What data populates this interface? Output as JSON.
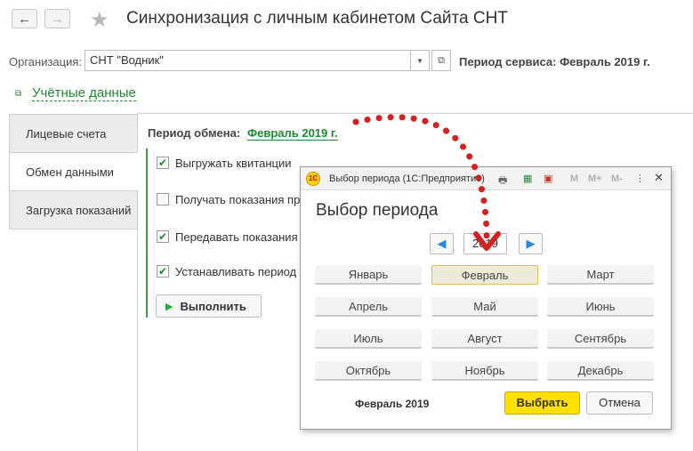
{
  "header": {
    "back_icon": "←",
    "forward_icon": "→",
    "favorite_icon": "★",
    "title": "Синхронизация с личным кабинетом Сайта СНТ"
  },
  "organization": {
    "label": "Организация:",
    "value": "СНТ \"Водник\"",
    "period_service": "Период сервиса: Февраль 2019 г."
  },
  "credentials_link": "Учётные данные",
  "tabs": [
    {
      "label": "Лицевые счета",
      "active": false
    },
    {
      "label": "Обмен данными",
      "active": true
    },
    {
      "label": "Загрузка показаний",
      "active": false
    }
  ],
  "exchange": {
    "period_label": "Период обмена:",
    "period_value": "Февраль 2019 г.",
    "options": [
      {
        "label": "Выгружать квитанции",
        "checked": true
      },
      {
        "label": "Получать показания пр",
        "checked": false
      },
      {
        "label": "Передавать показания",
        "checked": true
      },
      {
        "label": "Устанавливать период",
        "checked": true
      }
    ],
    "run_button": "Выполнить"
  },
  "dialog": {
    "caption": "Выбор периода  (1С:Предприятие)",
    "logo": "1С",
    "toolbar_m": [
      "M",
      "M+",
      "M-"
    ],
    "heading": "Выбор периода",
    "year": "2019",
    "months": [
      "Январь",
      "Февраль",
      "Март",
      "Апрель",
      "Май",
      "Июнь",
      "Июль",
      "Август",
      "Сентябрь",
      "Октябрь",
      "Ноябрь",
      "Декабрь"
    ],
    "selected_month_index": 1,
    "selected_text": "Февраль 2019",
    "select_button": "Выбрать",
    "cancel_button": "Отмена"
  },
  "colors": {
    "link_green": "#1e8a2e",
    "select_yellow": "#ffe000",
    "annotation_red": "#d42020"
  }
}
